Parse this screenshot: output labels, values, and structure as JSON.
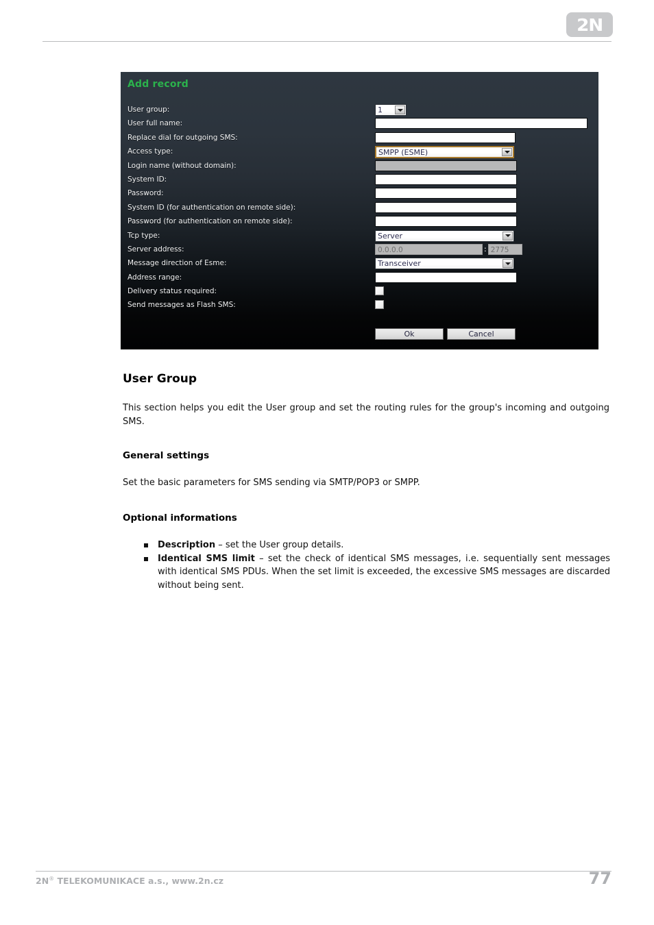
{
  "header": {
    "logo_text": "2N"
  },
  "screenshot": {
    "title": "Add record",
    "title_color": "#2bb24c",
    "fields": [
      {
        "label": "User group:",
        "type": "select",
        "value": "1"
      },
      {
        "label": "User full name:",
        "type": "text",
        "value": ""
      },
      {
        "label": "Replace dial for outgoing SMS:",
        "type": "text",
        "value": ""
      },
      {
        "label": "Access type:",
        "type": "select",
        "value": "SMPP (ESME)"
      },
      {
        "label": "Login name (without domain):",
        "type": "text",
        "value": "",
        "disabled": true
      },
      {
        "label": "System ID:",
        "type": "text",
        "value": ""
      },
      {
        "label": "Password:",
        "type": "text",
        "value": ""
      },
      {
        "label": "System ID (for authentication on remote side):",
        "type": "text",
        "value": ""
      },
      {
        "label": "Password (for authentication on remote side):",
        "type": "text",
        "value": ""
      },
      {
        "label": "Tcp type:",
        "type": "select",
        "value": "Server"
      },
      {
        "label": "Server address:",
        "type": "address",
        "value": "0.0.0.0",
        "port": "2775",
        "separator": ":"
      },
      {
        "label": "Message direction of Esme:",
        "type": "select",
        "value": "Transceiver"
      },
      {
        "label": "Address range:",
        "type": "text",
        "value": ""
      },
      {
        "label": "Delivery status required:",
        "type": "checkbox",
        "checked": false
      },
      {
        "label": "Send messages as Flash SMS:",
        "type": "checkbox",
        "checked": false
      }
    ],
    "buttons": {
      "ok": "Ok",
      "cancel": "Cancel"
    }
  },
  "content": {
    "heading": "User Group",
    "intro": "This section helps you edit the User group and set the routing rules for the group's incoming and outgoing SMS.",
    "general_settings_heading": "General settings",
    "general_settings_text": "Set the basic parameters for SMS sending via SMTP/POP3 or SMPP.",
    "optional_heading": "Optional informations",
    "bullets": [
      {
        "term": "Description",
        "text": " – set the User group details."
      },
      {
        "term": "Identical SMS limit",
        "text": " – set the check of identical SMS messages, i.e. sequentially sent messages with identical SMS PDUs. When the set limit is exceeded, the excessive SMS messages are discarded without being sent."
      }
    ]
  },
  "footer": {
    "company": "2N",
    "registered_mark": "®",
    "company_rest": " TELEKOMUNIKACE a.s., www.2n.cz",
    "page_number": "77"
  }
}
